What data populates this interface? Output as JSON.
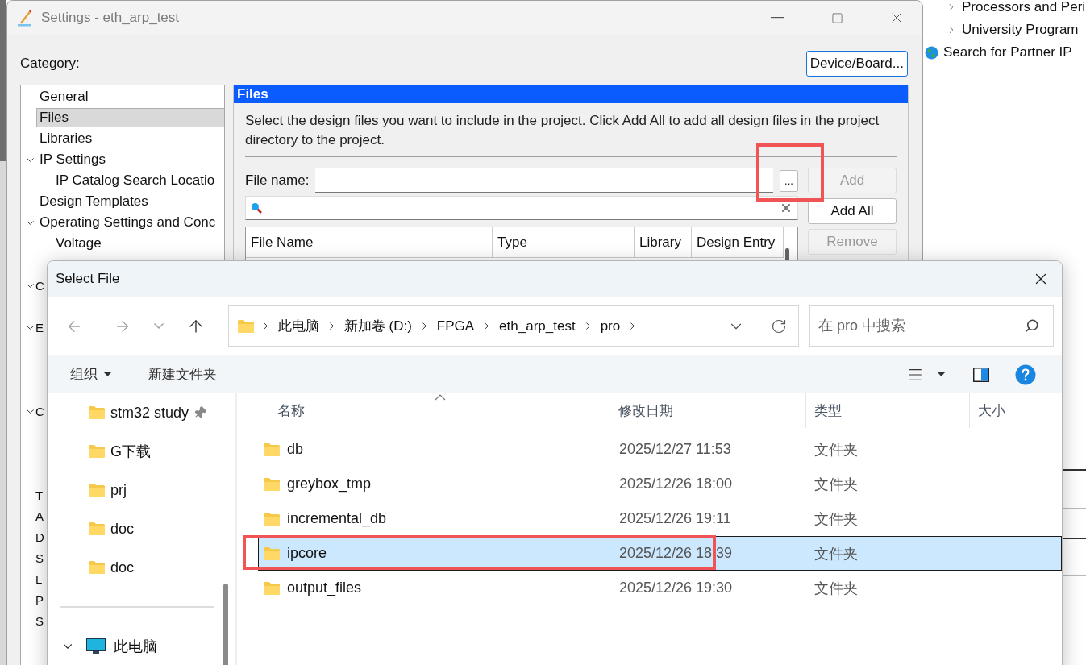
{
  "settings_window": {
    "title": "Settings - eth_arp_test",
    "category_label": "Category:",
    "device_button": "Device/Board...",
    "tree": {
      "items": [
        {
          "label": "General",
          "selected": false
        },
        {
          "label": "Files",
          "selected": true
        },
        {
          "label": "Libraries",
          "selected": false
        },
        {
          "label": "IP Settings",
          "expanded": true,
          "selected": false,
          "children": [
            {
              "label": "IP Catalog Search Locatio",
              "selected": false
            }
          ]
        },
        {
          "label": "Design Templates",
          "selected": false
        },
        {
          "label": "Operating Settings and Conc",
          "expanded": true,
          "selected": false,
          "children": [
            {
              "label": "Voltage",
              "selected": false
            }
          ]
        }
      ],
      "covered_items": [
        {
          "label": "C",
          "expanded": true
        },
        {
          "label": "E",
          "expanded": true
        },
        {
          "label": "C",
          "expanded": true
        },
        {
          "label": "T"
        },
        {
          "label": "A"
        },
        {
          "label": "D"
        },
        {
          "label": "S"
        },
        {
          "label": "L"
        },
        {
          "label": "P"
        },
        {
          "label": "S"
        }
      ]
    },
    "panel": {
      "title": "Files",
      "description": "Select the design files you want to include in the project. Click Add All to add all design files in the project directory to the project.",
      "file_name_label": "File name:",
      "browse_button": "...",
      "buttons": [
        {
          "label": "Add",
          "disabled": true
        },
        {
          "label": "Add All",
          "disabled": false
        },
        {
          "label": "Remove",
          "disabled": true
        }
      ],
      "table": {
        "columns": [
          "File Name",
          "Type",
          "Library",
          "Design Entry"
        ]
      }
    }
  },
  "ip_catalog": {
    "items": [
      {
        "label": "Processors and Peri",
        "kind": "folder"
      },
      {
        "label": "University Program",
        "kind": "folder"
      },
      {
        "label": "Search for Partner IP",
        "kind": "link"
      }
    ]
  },
  "file_dialog": {
    "title": "Select File",
    "breadcrumb": [
      "此电脑",
      "新加卷 (D:)",
      "FPGA",
      "eth_arp_test",
      "pro"
    ],
    "search": {
      "placeholder": "在 pro 中搜索"
    },
    "commands": [
      {
        "label": "组织",
        "kind": "menu"
      },
      {
        "label": "新建文件夹",
        "kind": "button"
      }
    ],
    "nav_pane": {
      "items": [
        {
          "label": "stm32 study",
          "pinned": true
        },
        {
          "label": "G下载",
          "pinned": false
        },
        {
          "label": "prj",
          "pinned": false
        },
        {
          "label": "doc",
          "pinned": false
        },
        {
          "label": "doc",
          "pinned": false
        }
      ],
      "this_pc": {
        "label": "此电脑",
        "expanded": true
      }
    },
    "columns": [
      "名称",
      "修改日期",
      "类型",
      "大小"
    ],
    "rows": [
      {
        "name": "db",
        "modified": "2025/12/27 11:53",
        "type": "文件夹",
        "selected": false
      },
      {
        "name": "greybox_tmp",
        "modified": "2025/12/26 18:00",
        "type": "文件夹",
        "selected": false
      },
      {
        "name": "incremental_db",
        "modified": "2025/12/26 19:11",
        "type": "文件夹",
        "selected": false
      },
      {
        "name": "ipcore",
        "modified": "2025/12/26 18:39",
        "type": "文件夹",
        "selected": true
      },
      {
        "name": "output_files",
        "modified": "2025/12/26 19:30",
        "type": "文件夹",
        "selected": false
      }
    ]
  }
}
